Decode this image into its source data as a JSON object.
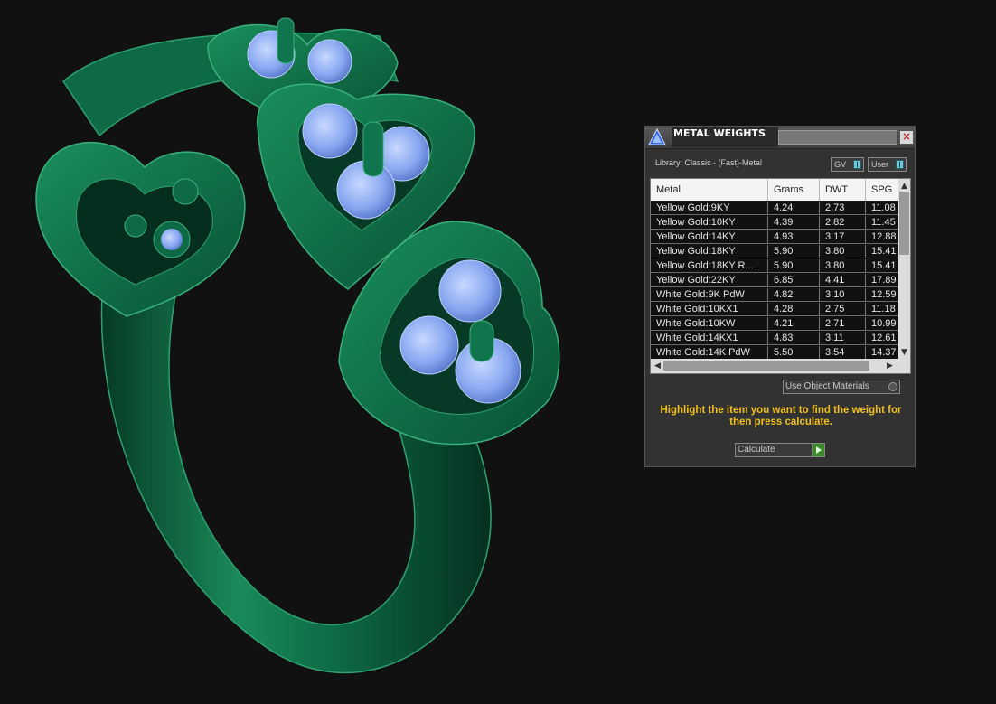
{
  "panel": {
    "title": "METAL WEIGHTS",
    "close_label": "×",
    "library_label": "Library: Classic - (Fast)-Metal",
    "toggle_gv": "GV",
    "toggle_user": "User",
    "columns": [
      "Metal",
      "Grams",
      "DWT",
      "SPG"
    ],
    "rows": [
      [
        "Yellow Gold:9KY",
        "4.24",
        "2.73",
        "11.08"
      ],
      [
        "Yellow Gold:10KY",
        "4.39",
        "2.82",
        "11.45"
      ],
      [
        "Yellow Gold:14KY",
        "4.93",
        "3.17",
        "12.88"
      ],
      [
        "Yellow Gold:18KY",
        "5.90",
        "3.80",
        "15.41"
      ],
      [
        "Yellow Gold:18KY R...",
        "5.90",
        "3.80",
        "15.41"
      ],
      [
        "Yellow Gold:22KY",
        "6.85",
        "4.41",
        "17.89"
      ],
      [
        "White Gold:9K PdW",
        "4.82",
        "3.10",
        "12.59"
      ],
      [
        "White Gold:10KX1",
        "4.28",
        "2.75",
        "11.18"
      ],
      [
        "White Gold:10KW",
        "4.21",
        "2.71",
        "10.99"
      ],
      [
        "White Gold:14KX1",
        "4.83",
        "3.11",
        "12.61"
      ],
      [
        "White Gold:14K PdW",
        "5.50",
        "3.54",
        "14.37"
      ]
    ],
    "use_object_materials": "Use Object Materials",
    "hint": "Highlight the item you want to find the weight for then press calculate.",
    "calculate_label": "Calculate"
  },
  "colors": {
    "background": "#111111",
    "ring_green": "#0f6a45",
    "gem_blue": "#8fb0ff",
    "hint_text": "#f0c020"
  }
}
